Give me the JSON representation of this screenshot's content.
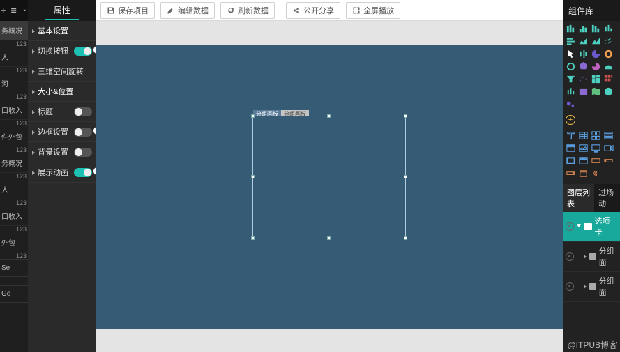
{
  "toolbar": {
    "save": "保存项目",
    "edit": "编辑数据",
    "refresh": "刷新数据",
    "share": "公开分享",
    "fullscreen": "全屏播放"
  },
  "leftOutline": {
    "items": [
      "务概况",
      "人",
      "河",
      "口收入",
      "件外包",
      "务概况",
      "人",
      "口收入",
      "外包"
    ],
    "num": "123",
    "se": "Se",
    "ge": "Ge"
  },
  "propTab": "属性",
  "props": {
    "basic": "基本设置",
    "switchBtn": "切换按钮",
    "rotate3d": "三维空间旋转",
    "sizepos": "大小&位置",
    "title": "标题",
    "border": "边框设置",
    "bg": "背景设置",
    "anim": "展示动画"
  },
  "canvasTabs": {
    "a": "分组画板",
    "b": "分组画板"
  },
  "compLib": "组件库",
  "bottomTabs": {
    "layers": "图层列表",
    "scene": "过场动"
  },
  "layers": {
    "root": "选项卡",
    "child1": "分组面",
    "child2": "分组面"
  },
  "watermark": "@ITPUB博客"
}
